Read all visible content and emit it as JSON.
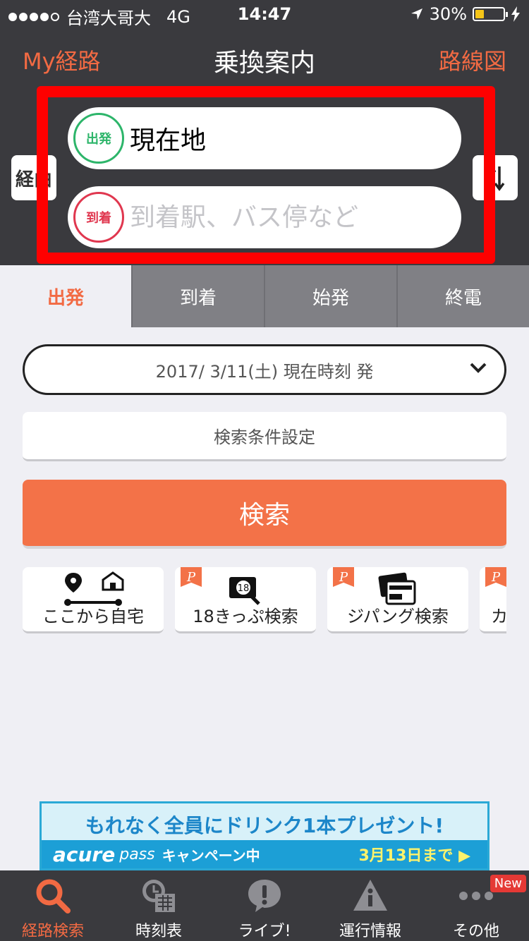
{
  "status": {
    "carrier": "台湾大哥大",
    "network": "4G",
    "time": "14:47",
    "battery": "30%"
  },
  "nav": {
    "left": "My経路",
    "title": "乗換案内",
    "right": "路線図"
  },
  "stations": {
    "via_label": "経由",
    "from_badge": "出発",
    "from_value": "現在地",
    "to_badge": "到着",
    "to_placeholder": "到着駅、バス停など"
  },
  "tabs": [
    {
      "label": "出発"
    },
    {
      "label": "到着"
    },
    {
      "label": "始発"
    },
    {
      "label": "終電"
    }
  ],
  "date_select": "2017/ 3/11(土) 現在時刻 発",
  "condition_button": "検索条件設定",
  "search_button": "検索",
  "shortcuts": [
    {
      "label": "ここから自宅",
      "icon": "home-route-icon"
    },
    {
      "label": "18きっぷ検索",
      "icon": "ticket-18-search-icon"
    },
    {
      "label": "ジパング検索",
      "icon": "zipangu-pass-icon"
    },
    {
      "label": "カ",
      "icon": "more-shortcut-icon"
    }
  ],
  "banner": {
    "headline": "もれなく全員にドリンク1本プレゼント!",
    "brand": "acure",
    "pass": "pass",
    "campaign": "キャンペーン中",
    "until": "3月13日まで ▶"
  },
  "tabbar": [
    {
      "label": "経路検索",
      "icon": "search-icon"
    },
    {
      "label": "時刻表",
      "icon": "timetable-icon"
    },
    {
      "label": "ライブ!",
      "icon": "live-icon"
    },
    {
      "label": "運行情報",
      "icon": "warning-icon"
    },
    {
      "label": "その他",
      "icon": "more-icon"
    }
  ],
  "new_badge": "New",
  "colors": {
    "accent": "#f26a43",
    "header_bg": "#3a3a3e",
    "highlight_frame": "#fe0000",
    "depart_green": "#2db56a",
    "arrive_red": "#e0374f"
  }
}
